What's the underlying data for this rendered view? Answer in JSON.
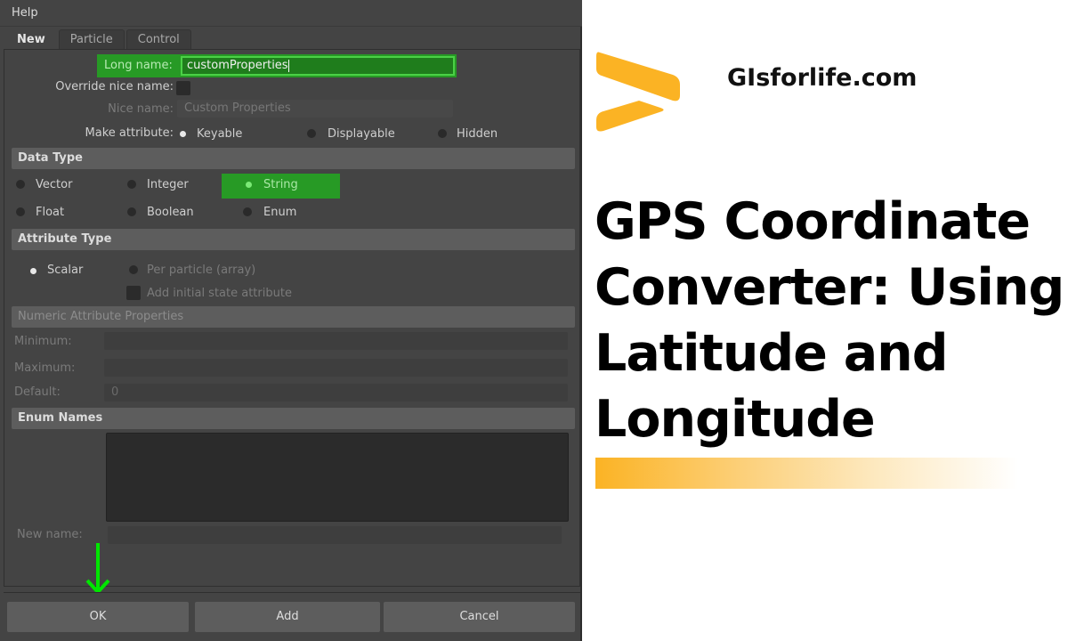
{
  "dialog": {
    "menu": {
      "help": "Help"
    },
    "tabs": [
      {
        "label": "New",
        "active": true
      },
      {
        "label": "Particle",
        "active": false
      },
      {
        "label": "Control",
        "active": false
      }
    ],
    "long_name": {
      "label": "Long name:",
      "value": "customProperties"
    },
    "override_nice_name": {
      "label": "Override nice name:",
      "checked": false
    },
    "nice_name": {
      "label": "Nice name:",
      "placeholder": "Custom Properties"
    },
    "make_attribute": {
      "label": "Make attribute:",
      "options": [
        "Keyable",
        "Displayable",
        "Hidden"
      ],
      "selected": "Keyable"
    },
    "data_type": {
      "title": "Data Type",
      "options": [
        "Vector",
        "Integer",
        "String",
        "Float",
        "Boolean",
        "Enum"
      ],
      "selected": "String"
    },
    "attribute_type": {
      "title": "Attribute Type",
      "options": [
        "Scalar",
        "Per particle (array)"
      ],
      "selected": "Scalar",
      "add_initial_state": {
        "label": "Add initial state attribute",
        "checked": false
      }
    },
    "numeric_properties": {
      "title": "Numeric Attribute Properties",
      "minimum_label": "Minimum:",
      "maximum_label": "Maximum:",
      "default_label": "Default:",
      "default_value": "0"
    },
    "enum_names": {
      "title": "Enum Names",
      "new_name_label": "New name:"
    },
    "buttons": {
      "ok": "OK",
      "add": "Add",
      "cancel": "Cancel"
    },
    "accent_color": "#279a25",
    "arrow_color": "#00e600"
  },
  "branding": {
    "site": "GIsforlife.com",
    "headline": "GPS Coordinate Converter: Using Latitude and Longitude",
    "brand_color": "#fbb324"
  }
}
